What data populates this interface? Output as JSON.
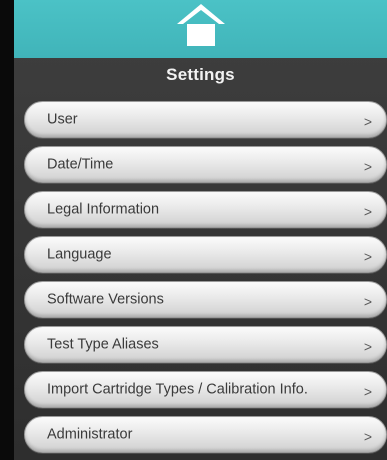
{
  "header": {
    "title": "Settings",
    "home_icon": "home-icon",
    "accent_color": "#45bcc0"
  },
  "menu": {
    "items": [
      {
        "label": "User",
        "chevron": ">"
      },
      {
        "label": "Date/Time",
        "chevron": ">"
      },
      {
        "label": "Legal Information",
        "chevron": ">"
      },
      {
        "label": "Language",
        "chevron": ">"
      },
      {
        "label": "Software Versions",
        "chevron": ">"
      },
      {
        "label": "Test Type Aliases",
        "chevron": ">"
      },
      {
        "label": "Import Cartridge Types / Calibration Info.",
        "chevron": ">"
      },
      {
        "label": "Administrator",
        "chevron": ">"
      }
    ]
  }
}
